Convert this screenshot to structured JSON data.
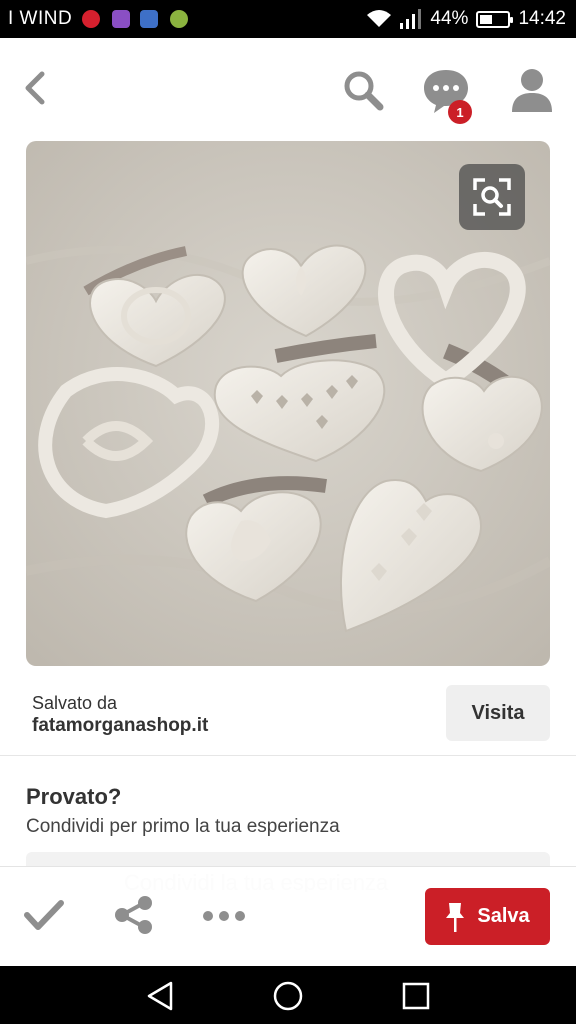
{
  "status_bar": {
    "carrier": "I WIND",
    "battery": "44%",
    "time": "14:42",
    "app_icons": [
      {
        "name": "pinterest-icon",
        "color": "#d6202e"
      },
      {
        "name": "gallery-icon",
        "color": "#8a4fc4"
      },
      {
        "name": "wifi-app-icon",
        "color": "#3e70c7"
      },
      {
        "name": "green-app-icon",
        "color": "#8bb33f"
      }
    ]
  },
  "header": {
    "notification_count": "1"
  },
  "pin": {
    "image_desc_icons": [
      "visual-search-icon"
    ]
  },
  "source": {
    "saved_label": "Salvato da",
    "domain": "fatamorganashop.it",
    "visit_label": "Visita"
  },
  "tried": {
    "title": "Provato?",
    "subtitle": "Condividi per primo la tua esperienza",
    "box_text": "Condividi la tua esperienza"
  },
  "actions": {
    "save_label": "Salva"
  },
  "colors": {
    "accent": "#cb1f27",
    "icon_gray": "#8e8e8e"
  }
}
